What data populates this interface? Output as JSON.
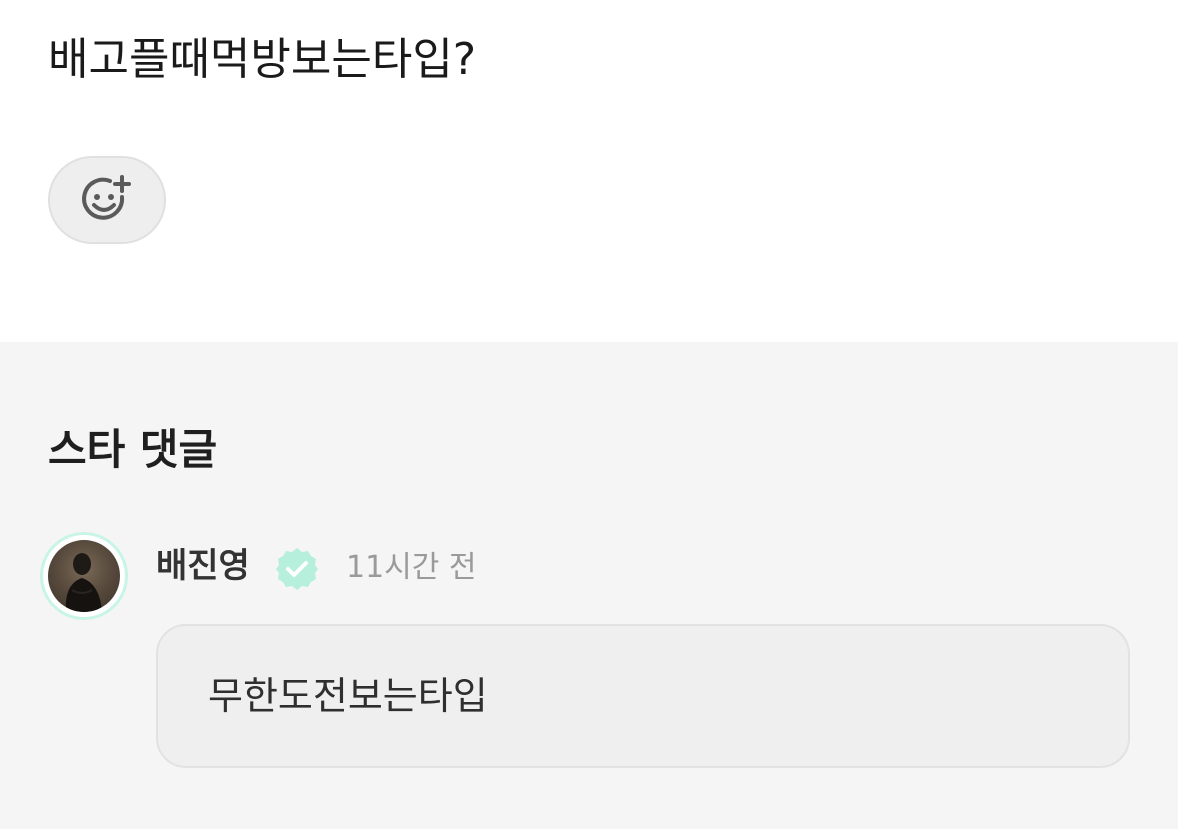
{
  "post": {
    "title": "배고플때먹방보는타입?",
    "reaction_button": {
      "icon": "smiley-plus-icon"
    }
  },
  "star_comments": {
    "section_title": "스타 댓글",
    "comments": [
      {
        "author": "배진영",
        "verified": true,
        "verified_icon": "verified-badge-icon",
        "time": "11시간 전",
        "text": "무한도전보는타입"
      }
    ]
  },
  "colors": {
    "verified": "#b6f0dc",
    "avatar_ring": "#c9f5e6",
    "section_bg": "#f5f5f5",
    "bubble_bg": "#efefef"
  }
}
